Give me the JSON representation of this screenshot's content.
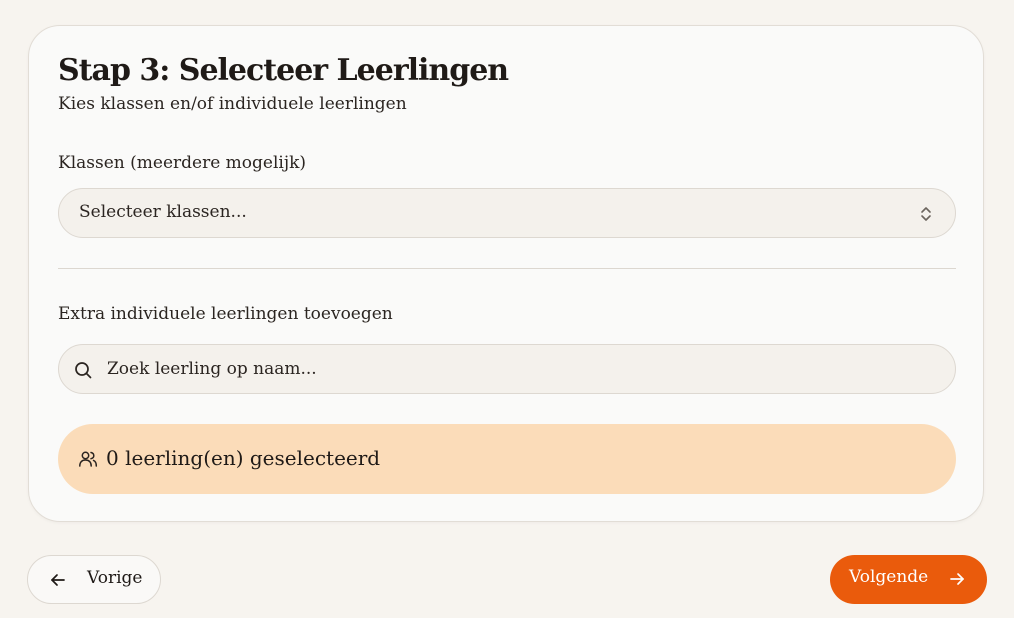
{
  "step": {
    "title": "Stap 3: Selecteer Leerlingen",
    "subtitle": "Kies klassen en/of individuele leerlingen"
  },
  "classes": {
    "label": "Klassen (meerdere mogelijk)",
    "placeholder": "Selecteer klassen...",
    "icon": "chevron-up-down-icon"
  },
  "extra": {
    "label": "Extra individuele leerlingen toevoegen",
    "search_placeholder": "Zoek leerling op naam...",
    "search_value": "",
    "icon": "search-icon"
  },
  "selection": {
    "text": "0 leerling(en) geselecteerd",
    "count": 0,
    "icon": "users-icon"
  },
  "nav": {
    "prev_label": "Vorige",
    "next_label": "Volgende",
    "prev_icon": "arrow-left-icon",
    "next_icon": "arrow-right-icon"
  },
  "colors": {
    "accent": "#ea5b0c",
    "selection_bg": "#fbdcb9",
    "page_bg": "#f7f4ef"
  }
}
